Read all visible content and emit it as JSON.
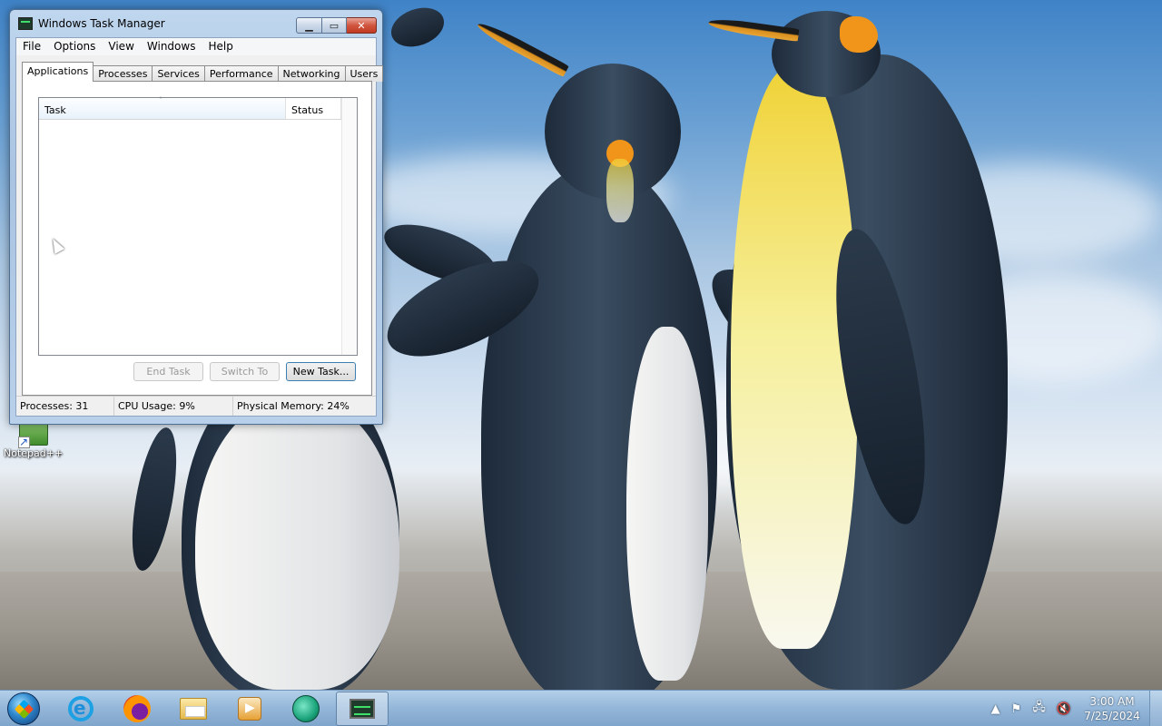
{
  "window": {
    "title": "Windows Task Manager",
    "caption_buttons": {
      "minimize": "▁",
      "maximize": "▭",
      "close": "✕"
    }
  },
  "menu": [
    "File",
    "Options",
    "View",
    "Windows",
    "Help"
  ],
  "tabs": {
    "items": [
      "Applications",
      "Processes",
      "Services",
      "Performance",
      "Networking",
      "Users"
    ],
    "active": "Applications"
  },
  "task_list": {
    "columns": [
      "Task",
      "Status"
    ],
    "sort_indicator": "˄",
    "rows": []
  },
  "buttons": {
    "end_task": "End Task",
    "switch_to": "Switch To",
    "new_task": "New Task..."
  },
  "status_bar": {
    "processes": "Processes: 31",
    "cpu": "CPU Usage: 9%",
    "memory": "Physical Memory: 24%"
  },
  "desktop_icons": [
    {
      "label": "Notepad++",
      "icon": "notepadpp-shortcut-icon"
    }
  ],
  "taskbar": {
    "start_icon": "windows-start-orb",
    "apps": [
      {
        "name": "internet-explorer",
        "icon": "ie-icon",
        "active": false
      },
      {
        "name": "firefox",
        "icon": "firefox-icon",
        "active": false
      },
      {
        "name": "windows-explorer",
        "icon": "folder-icon",
        "active": false
      },
      {
        "name": "media-player",
        "icon": "media-player-icon",
        "active": false
      },
      {
        "name": "notepadpp-app",
        "icon": "notepadpp-icon",
        "active": false
      },
      {
        "name": "task-manager",
        "icon": "task-manager-icon",
        "active": true
      }
    ],
    "tray": {
      "show_hidden": "▲",
      "flag": "⚑",
      "network": "🖧",
      "volume": "🔇"
    },
    "clock": {
      "time": "3:00 AM",
      "date": "7/25/2024"
    }
  },
  "colors": {
    "title_bar": "#bfd6ee",
    "close_button": "#c23a22",
    "taskbar": "#8eb2d6"
  }
}
